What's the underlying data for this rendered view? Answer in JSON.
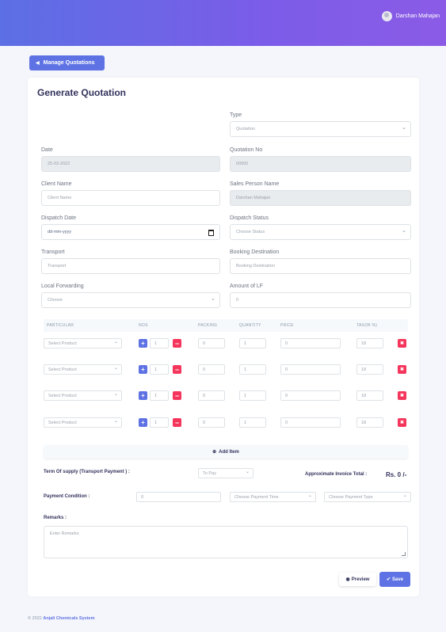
{
  "header": {
    "user_name": "Darshan Mahajan"
  },
  "nav": {
    "back_label": "Manage Quotations"
  },
  "form": {
    "title": "Generate Quotation",
    "type": {
      "label": "Type",
      "value": "Quotation"
    },
    "date": {
      "label": "Date",
      "value": "25-03-2022"
    },
    "quotation_no": {
      "label": "Quotation No",
      "value": "00000"
    },
    "client_name": {
      "label": "Client Name",
      "placeholder": "Client Name"
    },
    "sales_person": {
      "label": "Sales Person Name",
      "value": "Darshan Mahajan"
    },
    "dispatch_date": {
      "label": "Dispatch Date",
      "placeholder": "dd-mm-yyyy"
    },
    "dispatch_status": {
      "label": "Dispatch Status",
      "value": "Choose Status"
    },
    "transport": {
      "label": "Transport",
      "placeholder": "Transport"
    },
    "booking_destination": {
      "label": "Booking Destination",
      "placeholder": "Booking Destination"
    },
    "local_forwarding": {
      "label": "Local Forwarding",
      "value": "Choose"
    },
    "amount_lf": {
      "label": "Amount of LF",
      "value": "0"
    }
  },
  "items_table": {
    "columns": [
      "PARTICULAR",
      "NOS",
      "PACKING",
      "QUANTITY",
      "PRICE",
      "TAX(IN %)"
    ],
    "rows": [
      {
        "product": "Select Product",
        "nos": "1",
        "packing": "0",
        "quantity": "1",
        "price": "0",
        "tax": "18"
      },
      {
        "product": "Select Product",
        "nos": "1",
        "packing": "0",
        "quantity": "1",
        "price": "0",
        "tax": "18"
      },
      {
        "product": "Select Product",
        "nos": "1",
        "packing": "0",
        "quantity": "1",
        "price": "0",
        "tax": "18"
      },
      {
        "product": "Select Product",
        "nos": "1",
        "packing": "0",
        "quantity": "1",
        "price": "0",
        "tax": "18"
      }
    ],
    "add_item_label": "Add Item"
  },
  "summary": {
    "supply_label": "Term Of supply (Transport Payment ) :",
    "supply_value": "To Pay",
    "approx_label": "Approximate Invoice Total :",
    "approx_value": "Rs. 0 /-",
    "payment_condition_label": "Payment Condition :",
    "payment_condition_value": "0",
    "payment_time": "Choose Payment Time",
    "payment_type": "Choose Payment Type",
    "remarks_label": "Remarks :",
    "remarks_placeholder": "Enter Remarks"
  },
  "actions": {
    "preview_label": "Preview",
    "save_label": "Save"
  },
  "footer": {
    "year": "© 2022",
    "company": "Anjali Chemicals System"
  },
  "colors": {
    "primary": "#5e72e4",
    "danger": "#f5365c",
    "header_gradient_end": "#8b5be6"
  }
}
